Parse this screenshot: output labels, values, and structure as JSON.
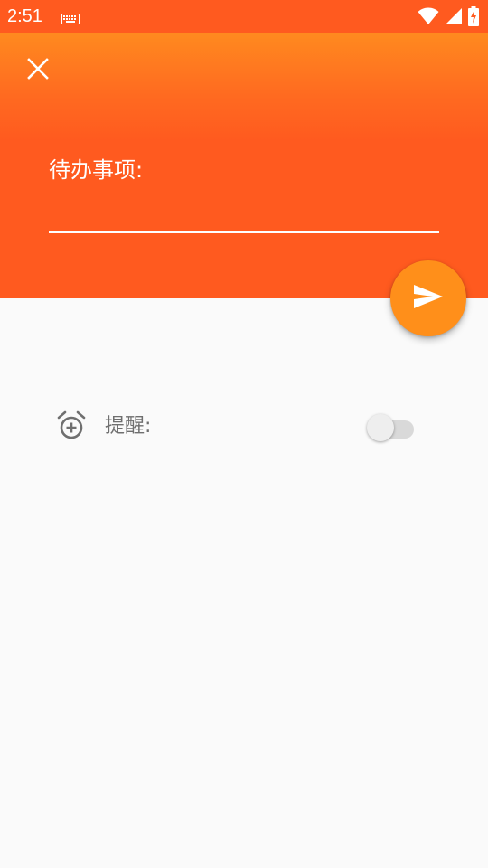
{
  "status_bar": {
    "time": "2:51",
    "icons": [
      "keyboard-icon",
      "wifi-icon",
      "signal-icon",
      "battery-charging-icon"
    ]
  },
  "header": {
    "close_icon": "close-icon",
    "todo_label": "待办事项:",
    "todo_value": "",
    "send_icon": "send-icon"
  },
  "reminder": {
    "icon": "alarm-add-icon",
    "label": "提醒:",
    "enabled": false
  },
  "colors": {
    "header_top": "#ff8a1f",
    "header": "#ff5a1f",
    "fab": "#ff8f1a",
    "background": "#fafafa",
    "label_gray": "#6f6f6f"
  }
}
